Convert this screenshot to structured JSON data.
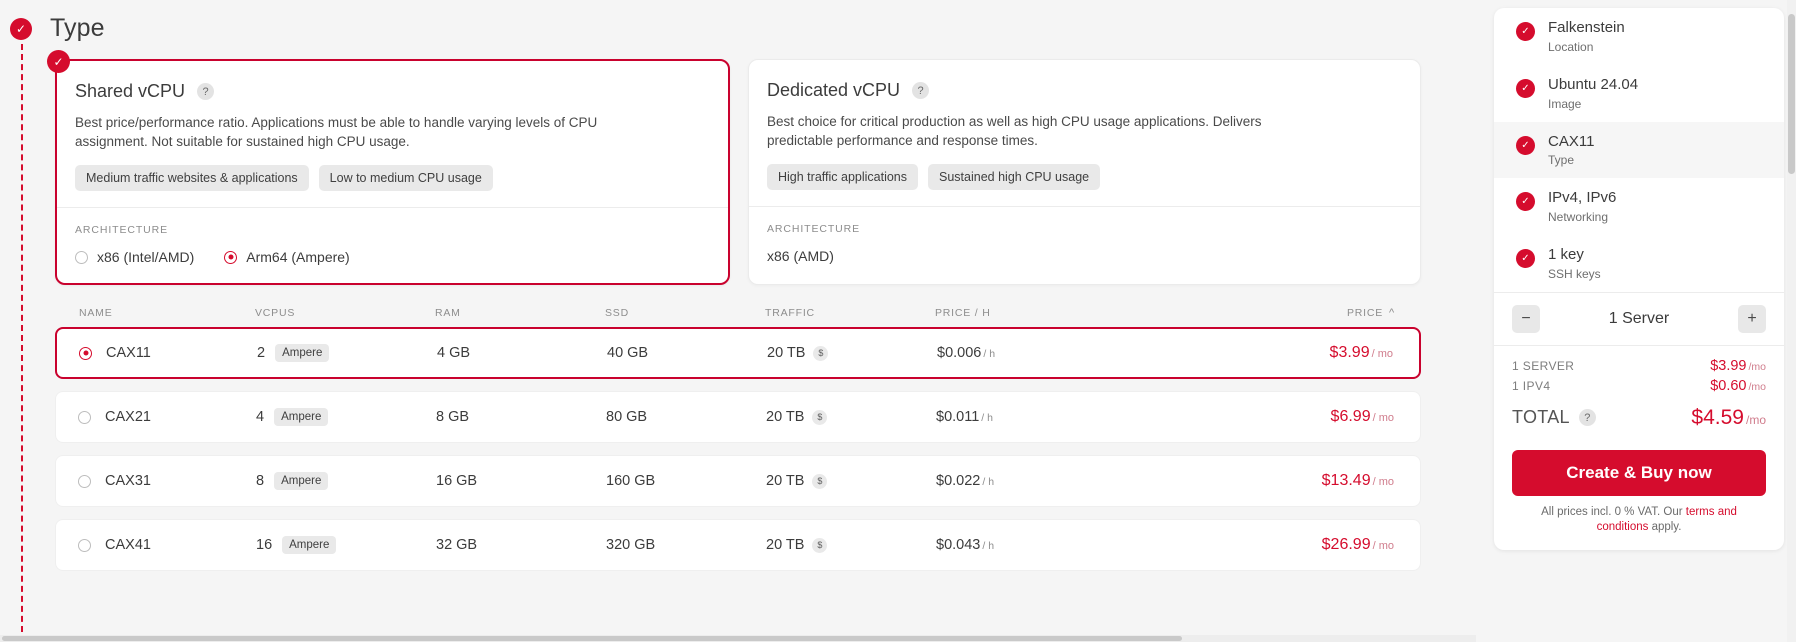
{
  "section": {
    "title": "Type",
    "check_icon": "check-icon"
  },
  "cards": [
    {
      "title": "Shared vCPU",
      "help_icon": "?",
      "description": "Best price/performance ratio. Applications must be able to handle varying levels of CPU assignment. Not suitable for sustained high CPU usage.",
      "tags": [
        "Medium traffic websites & applications",
        "Low to medium CPU usage"
      ],
      "arch_label": "ARCHITECTURE",
      "options": [
        {
          "label": "x86 (Intel/AMD)",
          "selected": false
        },
        {
          "label": "Arm64 (Ampere)",
          "selected": true
        }
      ],
      "selected": true
    },
    {
      "title": "Dedicated vCPU",
      "help_icon": "?",
      "description": "Best choice for critical production as well as high CPU usage applications. Delivers predictable performance and response times.",
      "tags": [
        "High traffic applications",
        "Sustained high CPU usage"
      ],
      "arch_label": "ARCHITECTURE",
      "arch_static": "x86 (AMD)",
      "selected": false
    }
  ],
  "table": {
    "headers": {
      "name": "NAME",
      "vcpus": "VCPUS",
      "ram": "RAM",
      "ssd": "SSD",
      "traffic": "TRAFFIC",
      "price_h": "PRICE / H",
      "price": "PRICE",
      "sort_icon": "chevron-up-icon"
    },
    "rows": [
      {
        "name": "CAX11",
        "vcpus": "2",
        "vendor": "Ampere",
        "ram": "4 GB",
        "ssd": "40 GB",
        "traffic": "20 TB",
        "traffic_icon": "$",
        "price_h": "$0.006",
        "price_h_unit": "/ h",
        "price": "$3.99",
        "price_unit": "/ mo",
        "selected": true
      },
      {
        "name": "CAX21",
        "vcpus": "4",
        "vendor": "Ampere",
        "ram": "8 GB",
        "ssd": "80 GB",
        "traffic": "20 TB",
        "traffic_icon": "$",
        "price_h": "$0.011",
        "price_h_unit": "/ h",
        "price": "$6.99",
        "price_unit": "/ mo",
        "selected": false
      },
      {
        "name": "CAX31",
        "vcpus": "8",
        "vendor": "Ampere",
        "ram": "16 GB",
        "ssd": "160 GB",
        "traffic": "20 TB",
        "traffic_icon": "$",
        "price_h": "$0.022",
        "price_h_unit": "/ h",
        "price": "$13.49",
        "price_unit": "/ mo",
        "selected": false
      },
      {
        "name": "CAX41",
        "vcpus": "16",
        "vendor": "Ampere",
        "ram": "32 GB",
        "ssd": "320 GB",
        "traffic": "20 TB",
        "traffic_icon": "$",
        "price_h": "$0.043",
        "price_h_unit": "/ h",
        "price": "$26.99",
        "price_unit": "/ mo",
        "selected": false
      }
    ]
  },
  "summary": {
    "items": [
      {
        "value": "Falkenstein",
        "key": "Location",
        "active": false
      },
      {
        "value": "Ubuntu 24.04",
        "key": "Image",
        "active": false
      },
      {
        "value": "CAX11",
        "key": "Type",
        "active": true
      },
      {
        "value": "IPv4, IPv6",
        "key": "Networking",
        "active": false
      },
      {
        "value": "1 key",
        "key": "SSH keys",
        "active": false
      }
    ],
    "counter": {
      "decrement_label": "−",
      "value": "1 Server",
      "increment_label": "+"
    },
    "lines": [
      {
        "key": "1 SERVER",
        "value": "$3.99",
        "unit": "/mo"
      },
      {
        "key": "1 IPV4",
        "value": "$0.60",
        "unit": "/mo"
      }
    ],
    "total": {
      "label": "TOTAL",
      "help_icon": "?",
      "value": "$4.59",
      "unit": "/mo"
    },
    "cta_label": "Create & Buy now",
    "fineprint_before": "All prices incl. 0 % VAT. Our ",
    "fineprint_link": "terms and conditions",
    "fineprint_after": " apply."
  },
  "colors": {
    "brand_red": "#d50c2d",
    "selected_border": "#c9022e",
    "page_bg": "#f5f5f5"
  }
}
